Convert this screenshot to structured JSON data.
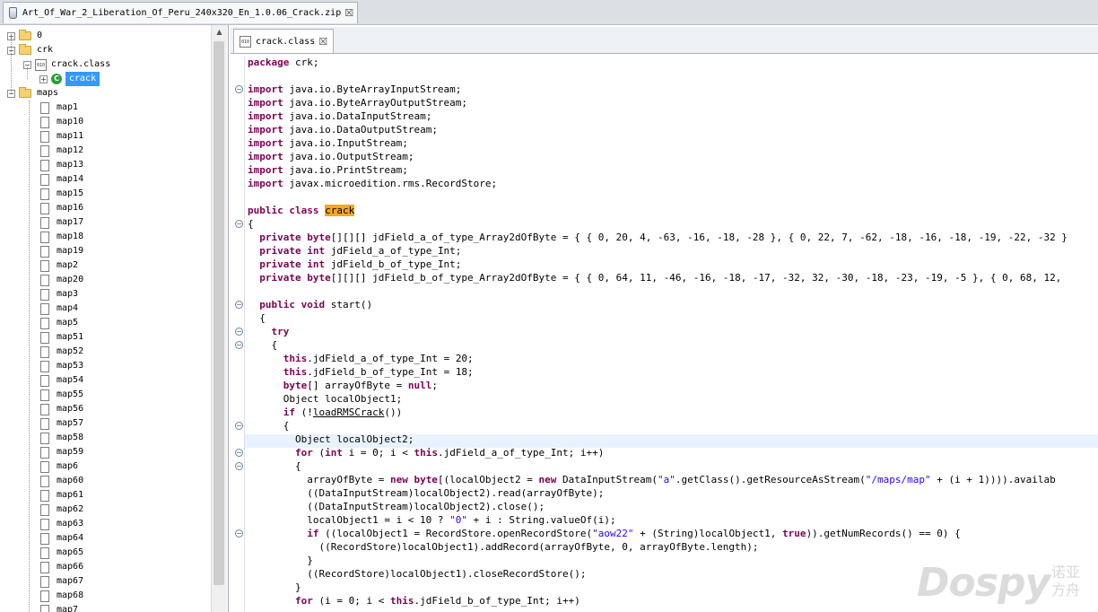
{
  "window": {
    "tab_title": "Art_Of_War_2_Liberation_Of_Peru_240x320_En_1.0.06_Crack.zip",
    "close_glyph": "☒"
  },
  "tree": {
    "root_items": [
      {
        "label": "0",
        "expanded": false
      },
      {
        "label": "crk",
        "expanded": true
      },
      {
        "label": "maps",
        "expanded": true
      }
    ],
    "crk_children": {
      "class_file": "crack.class",
      "class_name": "crack"
    },
    "maps": [
      "map1",
      "map10",
      "map11",
      "map12",
      "map13",
      "map14",
      "map15",
      "map16",
      "map17",
      "map18",
      "map19",
      "map2",
      "map20",
      "map3",
      "map4",
      "map5",
      "map51",
      "map52",
      "map53",
      "map54",
      "map55",
      "map56",
      "map57",
      "map58",
      "map59",
      "map6",
      "map60",
      "map61",
      "map62",
      "map63",
      "map64",
      "map65",
      "map66",
      "map67",
      "map68",
      "map7"
    ]
  },
  "editor": {
    "tab_label": "crack.class",
    "lines": [
      [
        [
          "k",
          "package"
        ],
        [
          "t",
          " crk;"
        ]
      ],
      [],
      [
        [
          "k",
          "import"
        ],
        [
          "t",
          " java.io.ByteArrayInputStream;"
        ]
      ],
      [
        [
          "k",
          "import"
        ],
        [
          "t",
          " java.io.ByteArrayOutputStream;"
        ]
      ],
      [
        [
          "k",
          "import"
        ],
        [
          "t",
          " java.io.DataInputStream;"
        ]
      ],
      [
        [
          "k",
          "import"
        ],
        [
          "t",
          " java.io.DataOutputStream;"
        ]
      ],
      [
        [
          "k",
          "import"
        ],
        [
          "t",
          " java.io.InputStream;"
        ]
      ],
      [
        [
          "k",
          "import"
        ],
        [
          "t",
          " java.io.OutputStream;"
        ]
      ],
      [
        [
          "k",
          "import"
        ],
        [
          "t",
          " java.io.PrintStream;"
        ]
      ],
      [
        [
          "k",
          "import"
        ],
        [
          "t",
          " javax.microedition.rms.RecordStore;"
        ]
      ],
      [],
      [
        [
          "k",
          "public class "
        ],
        [
          "h",
          "crack"
        ]
      ],
      [
        [
          "t",
          "{"
        ]
      ],
      [
        [
          "t",
          "  "
        ],
        [
          "k",
          "private byte"
        ],
        [
          "t",
          "[][][] jdField_a_of_type_Array2dOfByte = { { 0, 20, 4, -63, -16, -18, -28 }, { 0, 22, 7, -62, -18, -16, -18, -19, -22, -32 }"
        ]
      ],
      [
        [
          "t",
          "  "
        ],
        [
          "k",
          "private int"
        ],
        [
          "t",
          " jdField_a_of_type_Int;"
        ]
      ],
      [
        [
          "t",
          "  "
        ],
        [
          "k",
          "private int"
        ],
        [
          "t",
          " jdField_b_of_type_Int;"
        ]
      ],
      [
        [
          "t",
          "  "
        ],
        [
          "k",
          "private byte"
        ],
        [
          "t",
          "[][][] jdField_b_of_type_Array2dOfByte = { { 0, 64, 11, -46, -16, -18, -17, -32, 32, -30, -18, -23, -19, -5 }, { 0, 68, 12,"
        ]
      ],
      [],
      [
        [
          "t",
          "  "
        ],
        [
          "k",
          "public void"
        ],
        [
          "t",
          " start()"
        ]
      ],
      [
        [
          "t",
          "  {"
        ]
      ],
      [
        [
          "t",
          "    "
        ],
        [
          "k",
          "try"
        ]
      ],
      [
        [
          "t",
          "    {"
        ]
      ],
      [
        [
          "t",
          "      "
        ],
        [
          "k",
          "this"
        ],
        [
          "t",
          ".jdField_a_of_type_Int = 20;"
        ]
      ],
      [
        [
          "t",
          "      "
        ],
        [
          "k",
          "this"
        ],
        [
          "t",
          ".jdField_b_of_type_Int = 18;"
        ]
      ],
      [
        [
          "t",
          "      "
        ],
        [
          "k",
          "byte"
        ],
        [
          "t",
          "[] arrayOfByte = "
        ],
        [
          "k",
          "null"
        ],
        [
          "t",
          ";"
        ]
      ],
      [
        [
          "t",
          "      Object localObject1;"
        ]
      ],
      [
        [
          "t",
          "      "
        ],
        [
          "k",
          "if"
        ],
        [
          "t",
          " (!"
        ],
        [
          "u",
          "loadRMSCrack"
        ],
        [
          "t",
          "())"
        ]
      ],
      [
        [
          "t",
          "      {"
        ]
      ],
      [
        [
          "t",
          "        Object localObject2;"
        ]
      ],
      [
        [
          "t",
          "        "
        ],
        [
          "k",
          "for"
        ],
        [
          "t",
          " ("
        ],
        [
          "k",
          "int"
        ],
        [
          "t",
          " i = 0; i < "
        ],
        [
          "k",
          "this"
        ],
        [
          "t",
          ".jdField_a_of_type_Int; i++)"
        ]
      ],
      [
        [
          "t",
          "        {"
        ]
      ],
      [
        [
          "t",
          "          arrayOfByte = "
        ],
        [
          "k",
          "new byte"
        ],
        [
          "t",
          "[(localObject2 = "
        ],
        [
          "k",
          "new"
        ],
        [
          "t",
          " DataInputStream("
        ],
        [
          "s",
          "\"a\""
        ],
        [
          "t",
          ".getClass().getResourceAsStream("
        ],
        [
          "s",
          "\"/maps/map\""
        ],
        [
          "t",
          " + (i + 1)))).availab"
        ]
      ],
      [
        [
          "t",
          "          ((DataInputStream)localObject2).read(arrayOfByte);"
        ]
      ],
      [
        [
          "t",
          "          ((DataInputStream)localObject2).close();"
        ]
      ],
      [
        [
          "t",
          "          localObject1 = i < 10 ? "
        ],
        [
          "s",
          "\"0\""
        ],
        [
          "t",
          " + i : String.valueOf(i);"
        ]
      ],
      [
        [
          "t",
          "          "
        ],
        [
          "k",
          "if"
        ],
        [
          "t",
          " ((localObject1 = RecordStore.openRecordStore("
        ],
        [
          "s",
          "\"aow22\""
        ],
        [
          "t",
          " + (String)localObject1, "
        ],
        [
          "k",
          "true"
        ],
        [
          "t",
          ")).getNumRecords() == 0) {"
        ]
      ],
      [
        [
          "t",
          "            ((RecordStore)localObject1).addRecord(arrayOfByte, 0, arrayOfByte.length);"
        ]
      ],
      [
        [
          "t",
          "          }"
        ]
      ],
      [
        [
          "t",
          "          ((RecordStore)localObject1).closeRecordStore();"
        ]
      ],
      [
        [
          "t",
          "        }"
        ]
      ],
      [
        [
          "t",
          "        "
        ],
        [
          "k",
          "for"
        ],
        [
          "t",
          " (i = 0; i < "
        ],
        [
          "k",
          "this"
        ],
        [
          "t",
          ".jdField_b_of_type_Int; i++)"
        ]
      ]
    ]
  },
  "watermark": {
    "brand": "Dospy",
    "cn": "诺亚方舟"
  }
}
